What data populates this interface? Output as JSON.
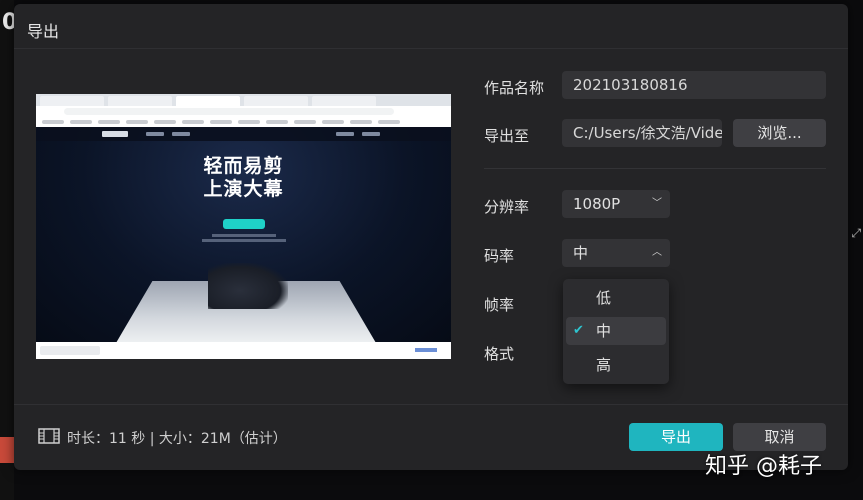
{
  "dialog": {
    "title": "导出"
  },
  "form": {
    "name_label": "作品名称",
    "name_value": "202103180816",
    "path_label": "导出至",
    "path_value": "C:/Users/徐文浩/Vide",
    "browse_label": "浏览...",
    "resolution_label": "分辨率",
    "resolution_value": "1080P",
    "bitrate_label": "码率",
    "bitrate_value": "中",
    "framerate_label": "帧率",
    "format_label": "格式"
  },
  "bitrate_options": [
    {
      "label": "低",
      "selected": false
    },
    {
      "label": "中",
      "selected": true
    },
    {
      "label": "高",
      "selected": false
    }
  ],
  "preview": {
    "headline_line1": "轻而易剪",
    "headline_line2": "上演大幕"
  },
  "footer": {
    "info": "时长：11 秒 | 大小：21M（估计）",
    "export_label": "导出",
    "cancel_label": "取消"
  },
  "watermark": "知乎 @耗子",
  "colors": {
    "accent": "#1fb5bf",
    "dialog_bg": "#242426",
    "field_bg": "#333336"
  }
}
